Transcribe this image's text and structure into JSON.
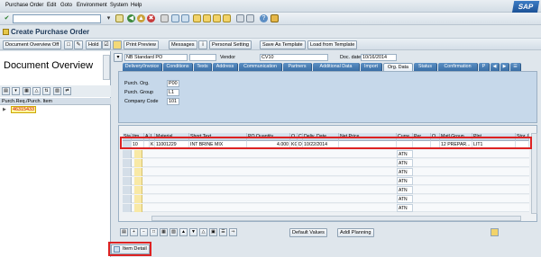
{
  "menu": {
    "items": [
      "Purchase Order",
      "Edit",
      "Goto",
      "Environment",
      "System",
      "Help"
    ],
    "logo": "SAP"
  },
  "title": "Create Purchase Order",
  "app_toolbar": {
    "doc_overview_off": "Document Overview Off",
    "hold": "Hold",
    "print_preview": "Print Preview",
    "messages": "Messages",
    "personal_setting": "Personal Setting",
    "save_as_template": "Save As Template",
    "load_from_template": "Load from Template"
  },
  "left_panel": {
    "title": "Document Overview",
    "column_header": "Purch.Req./Purch. Item",
    "item": "46315433"
  },
  "header": {
    "doc_type": "NB Standard PO",
    "vendor_label": "Vendor",
    "vendor_value": "CV10",
    "doc_date_label": "Doc. date",
    "doc_date_value": "10/16/2014"
  },
  "tabs": [
    "Delivery/Invoice",
    "Conditions",
    "Texts",
    "Address",
    "Communication",
    "Partners",
    "Additional Data",
    "Import",
    "Org. Data",
    "Status",
    "Confirmation",
    "P"
  ],
  "active_tab": "Org. Data",
  "org_data": {
    "purch_org_label": "Purch. Org.",
    "purch_org_value": "P00",
    "purch_group_label": "Purch. Group",
    "purch_group_value": "L1",
    "company_code_label": "Company Code",
    "company_code_value": "101"
  },
  "grid": {
    "columns": [
      "Sta",
      "Itm",
      "A",
      "I",
      "Material",
      "Short Text",
      "PO Quantity",
      "O.",
      "C",
      "Deliv. Date",
      "Net Price",
      "Curre",
      "Per",
      "O",
      "Matl Group",
      "Plnt",
      "Stor. L"
    ],
    "row": {
      "itm": "10",
      "i": "K",
      "material": "11001229",
      "short_text": "INT BRINE MIX",
      "po_quantity": "4.000",
      "o": "KG",
      "c": "D",
      "deliv_date": "10/22/2014",
      "matl_group": "12 PREPAR...",
      "plnt": "LIT1"
    },
    "empty_currency": "ATN"
  },
  "bottom": {
    "default_values": "Default Values",
    "addl_planning": "Addl Planning",
    "item_detail": "Item Detail"
  },
  "colors": {
    "accent": "#3a6ea5",
    "highlight": "#d22222",
    "background": "#dfe6ec"
  }
}
